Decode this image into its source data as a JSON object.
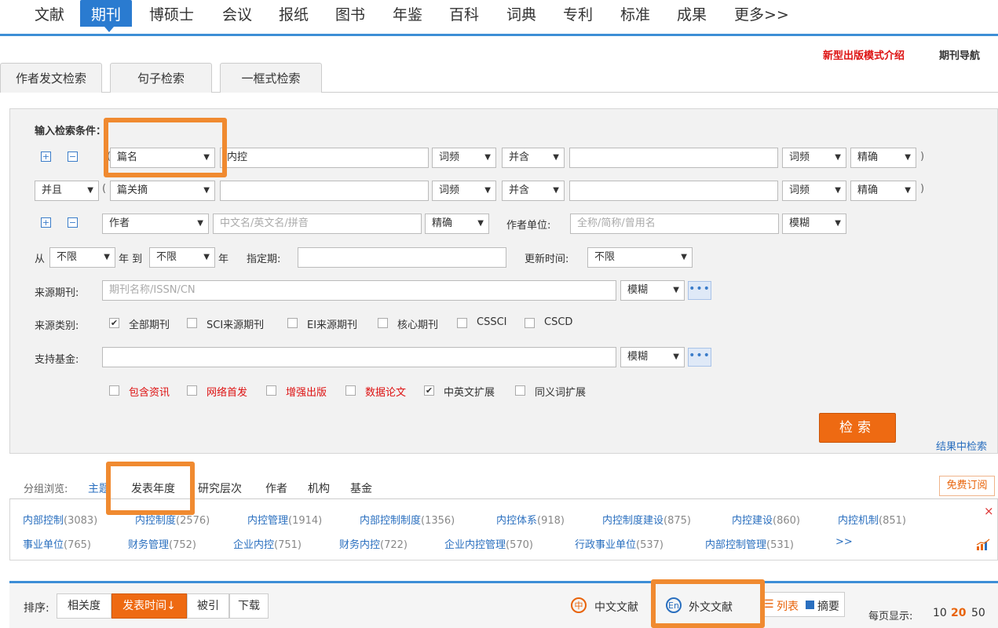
{
  "topnav": {
    "items": [
      "文献",
      "期刊",
      "博硕士",
      "会议",
      "报纸",
      "图书",
      "年鉴",
      "百科",
      "词典",
      "专利",
      "标准",
      "成果",
      "更多>>"
    ],
    "active": "期刊"
  },
  "links": {
    "new_publish": "新型出版模式介绍",
    "journal_nav": "期刊导航"
  },
  "search_tabs": [
    "作者发文检索",
    "句子检索",
    "一框式检索"
  ],
  "form": {
    "section_label": "输入检索条件：",
    "row1": {
      "field": "篇名",
      "value": "内控",
      "freq1": "词频",
      "logic": "并含",
      "value2": "",
      "freq2": "词频",
      "match": "精确"
    },
    "row2": {
      "op": "并且",
      "field": "篇关摘",
      "value": "",
      "freq1": "词频",
      "logic": "并含",
      "value2": "",
      "freq2": "词频",
      "match": "精确"
    },
    "row3": {
      "field": "作者",
      "author_placeholder": "中文名/英文名/拼音",
      "match": "精确",
      "unit_label": "作者单位:",
      "unit_placeholder": "全称/简称/曾用名",
      "unit_match": "模糊"
    },
    "row4": {
      "from": "从",
      "from_value": "不限",
      "year_to": "年 到",
      "to_value": "不限",
      "year": "年",
      "specified_label": "指定期:",
      "update_label": "更新时间:",
      "update_value": "不限"
    },
    "source": {
      "label": "来源期刊:",
      "placeholder": "期刊名称/ISSN/CN",
      "match": "模糊"
    },
    "category": {
      "label": "来源类别:",
      "options": [
        {
          "label": "全部期刊",
          "checked": true
        },
        {
          "label": "SCI来源期刊",
          "checked": false
        },
        {
          "label": "EI来源期刊",
          "checked": false
        },
        {
          "label": "核心期刊",
          "checked": false
        },
        {
          "label": "CSSCI",
          "checked": false
        },
        {
          "label": "CSCD",
          "checked": false
        }
      ]
    },
    "fund": {
      "label": "支持基金:",
      "match": "模糊"
    },
    "extras": [
      {
        "label": "包含资讯",
        "checked": false,
        "red": true
      },
      {
        "label": "网络首发",
        "checked": false,
        "red": true
      },
      {
        "label": "增强出版",
        "checked": false,
        "red": true
      },
      {
        "label": "数据论文",
        "checked": false,
        "red": true
      },
      {
        "label": "中英文扩展",
        "checked": true,
        "red": false
      },
      {
        "label": "同义词扩展",
        "checked": false,
        "red": false
      }
    ],
    "search_button": "检索",
    "search_in_results": "结果中检索"
  },
  "group": {
    "label": "分组浏览:",
    "tabs": [
      "主题",
      "发表年度",
      "研究层次",
      "作者",
      "机构",
      "基金"
    ],
    "subscribe": "免费订阅"
  },
  "keywords_row1": [
    {
      "name": "内部控制",
      "count": "(3083)"
    },
    {
      "name": "内控制度",
      "count": "(2576)"
    },
    {
      "name": "内控管理",
      "count": "(1914)"
    },
    {
      "name": "内部控制制度",
      "count": "(1356)"
    },
    {
      "name": "内控体系",
      "count": "(918)"
    },
    {
      "name": "内控制度建设",
      "count": "(875)"
    },
    {
      "name": "内控建设",
      "count": "(860)"
    },
    {
      "name": "内控机制",
      "count": "(851)"
    }
  ],
  "keywords_row2": [
    {
      "name": "事业单位",
      "count": "(765)"
    },
    {
      "name": "财务管理",
      "count": "(752)"
    },
    {
      "name": "企业内控",
      "count": "(751)"
    },
    {
      "name": "财务内控",
      "count": "(722)"
    },
    {
      "name": "企业内控管理",
      "count": "(570)"
    },
    {
      "name": "行政事业单位",
      "count": "(537)"
    },
    {
      "name": "内部控制管理",
      "count": "(531)"
    }
  ],
  "more": ">>",
  "close": "×",
  "sort": {
    "label": "排序:",
    "options": [
      "相关度",
      "发表时间↓",
      "被引",
      "下载"
    ],
    "active": "发表时间↓",
    "cn_docs": "中文文献",
    "en_docs": "外文文献",
    "view_list": "列表",
    "view_abstract": "摘要",
    "per_page_label": "每页显示:",
    "per_page": [
      "10",
      "20",
      "50"
    ],
    "per_page_active": "20"
  }
}
